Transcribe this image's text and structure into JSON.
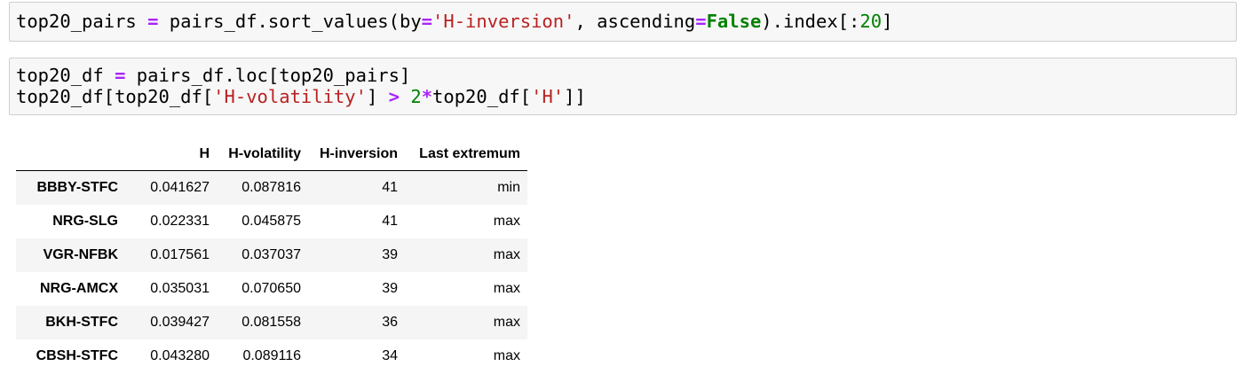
{
  "cells": [
    {
      "tokens": [
        {
          "t": "top20_pairs ",
          "c": ""
        },
        {
          "t": "=",
          "c": "op"
        },
        {
          "t": " pairs_df.sort_values(by",
          "c": ""
        },
        {
          "t": "=",
          "c": "op"
        },
        {
          "t": "'H-inversion'",
          "c": "str"
        },
        {
          "t": ", ascending",
          "c": ""
        },
        {
          "t": "=",
          "c": "op"
        },
        {
          "t": "False",
          "c": "kw"
        },
        {
          "t": ").index[:",
          "c": ""
        },
        {
          "t": "20",
          "c": "num"
        },
        {
          "t": "]",
          "c": ""
        }
      ]
    },
    {
      "tokens": [
        {
          "t": "top20_df ",
          "c": ""
        },
        {
          "t": "=",
          "c": "op"
        },
        {
          "t": " pairs_df.loc[top20_pairs]\ntop20_df[top20_df[",
          "c": ""
        },
        {
          "t": "'H-volatility'",
          "c": "str"
        },
        {
          "t": "] ",
          "c": ""
        },
        {
          "t": ">",
          "c": "op"
        },
        {
          "t": " ",
          "c": ""
        },
        {
          "t": "2",
          "c": "num"
        },
        {
          "t": "*",
          "c": "op"
        },
        {
          "t": "top20_df[",
          "c": ""
        },
        {
          "t": "'H'",
          "c": "str"
        },
        {
          "t": "]]",
          "c": ""
        }
      ]
    }
  ],
  "output_table": {
    "columns": [
      "",
      "H",
      "H-volatility",
      "H-inversion",
      "Last extremum"
    ],
    "rows": [
      {
        "index": "BBBY-STFC",
        "H": "0.041627",
        "H_volatility": "0.087816",
        "H_inversion": "41",
        "last_extremum": "min"
      },
      {
        "index": "NRG-SLG",
        "H": "0.022331",
        "H_volatility": "0.045875",
        "H_inversion": "41",
        "last_extremum": "max"
      },
      {
        "index": "VGR-NFBK",
        "H": "0.017561",
        "H_volatility": "0.037037",
        "H_inversion": "39",
        "last_extremum": "max"
      },
      {
        "index": "NRG-AMCX",
        "H": "0.035031",
        "H_volatility": "0.070650",
        "H_inversion": "39",
        "last_extremum": "max"
      },
      {
        "index": "BKH-STFC",
        "H": "0.039427",
        "H_volatility": "0.081558",
        "H_inversion": "36",
        "last_extremum": "max"
      },
      {
        "index": "CBSH-STFC",
        "H": "0.043280",
        "H_volatility": "0.089116",
        "H_inversion": "34",
        "last_extremum": "max"
      }
    ]
  },
  "colors": {
    "operator": "#aa22ff",
    "string": "#ba2121",
    "keyword": "#008000",
    "number": "#008000",
    "cell_background": "#f7f7f7",
    "cell_border": "#cfcfcf",
    "striped_row": "#f5f5f5"
  }
}
